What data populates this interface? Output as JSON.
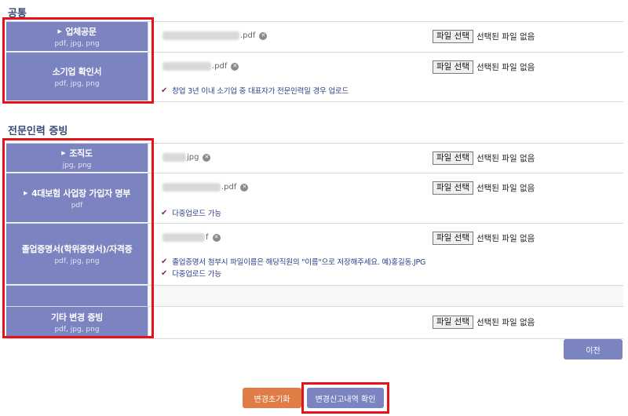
{
  "sections": {
    "common": {
      "title": "공통"
    },
    "expert": {
      "title": "전문인력 증빙"
    }
  },
  "upload": {
    "button_label": "파일 선택",
    "no_file_text": "선택된 파일 없음"
  },
  "rows": {
    "company_doc": {
      "label": "업체공문",
      "formats": "pdf, jpg, png",
      "file_ext": ".pdf"
    },
    "small_biz": {
      "label": "소기업 확인서",
      "formats": "pdf, jpg, png",
      "file_ext": ".pdf",
      "note": "창업 3년 이내 소기업 중 대표자가 전문인력일 경우 업로드"
    },
    "org_chart": {
      "label": "조직도",
      "formats": "jpg, png",
      "file_ext": "jpg"
    },
    "insurance": {
      "label": "4대보험 사업장 가입자 명부",
      "formats": "pdf",
      "file_ext": ".pdf",
      "note": "다중업로드 가능"
    },
    "graduation": {
      "label": "졸업증명서(학위증명서)/자격증",
      "formats": "pdf, jpg, png",
      "file_ext": "f",
      "note1": "졸업증명서 첨부시 파일이름은 해당직원의 \"이름\"으로 저장해주세요. 예)홍길동.JPG",
      "note2": "다중업로드 가능"
    },
    "other": {
      "label": "기타 변경 증빙",
      "formats": "pdf, jpg, png"
    }
  },
  "buttons": {
    "prev": "이전",
    "reset": "변경초기화",
    "confirm": "변경신고내역 확인"
  },
  "colors": {
    "header_bg": "#7b83c0",
    "highlight": "#e3121b",
    "reset_btn": "#e07c45",
    "note_text": "#2d3d8a"
  }
}
